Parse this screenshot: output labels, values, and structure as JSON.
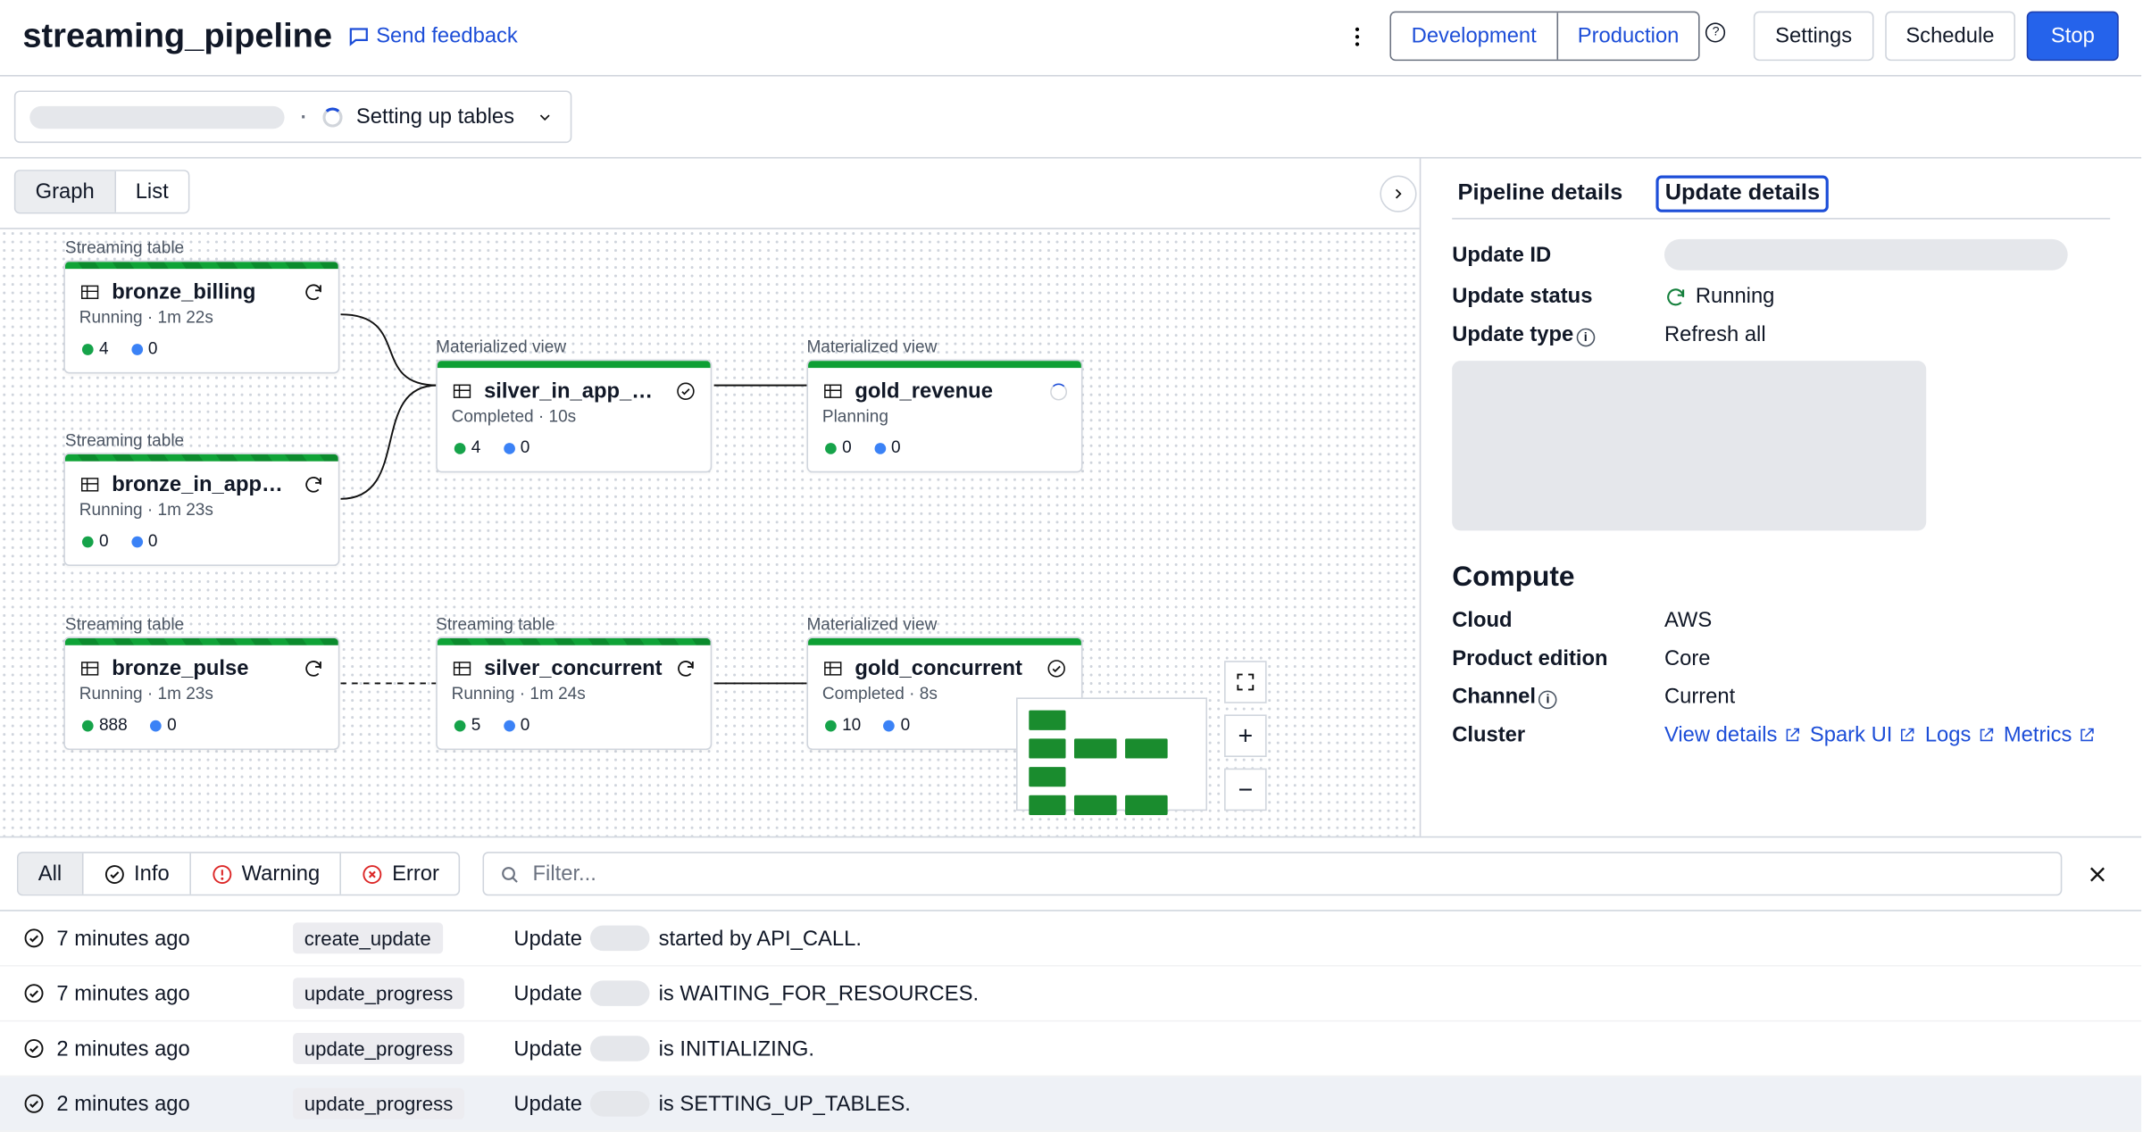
{
  "header": {
    "title": "streaming_pipeline",
    "feedback": "Send feedback",
    "env": {
      "dev": "Development",
      "prod": "Production"
    },
    "settings": "Settings",
    "schedule": "Schedule",
    "stop": "Stop"
  },
  "status_pill": {
    "text": "Setting up tables"
  },
  "view_tabs": {
    "graph": "Graph",
    "list": "List"
  },
  "groups": {
    "stream1": "Streaming table",
    "stream2": "Streaming table",
    "stream3": "Streaming table",
    "stream4": "Streaming table",
    "mat1": "Materialized view",
    "mat2": "Materialized view",
    "mat3": "Materialized view"
  },
  "nodes": {
    "bronze_billing": {
      "name": "bronze_billing",
      "meta": "Running · 1m 22s",
      "g": "4",
      "b": "0",
      "icon": "refresh"
    },
    "bronze_in_app": {
      "name": "bronze_in_app_pu…",
      "meta": "Running · 1m 23s",
      "g": "0",
      "b": "0",
      "icon": "refresh"
    },
    "silver_in_app": {
      "name": "silver_in_app_purc…",
      "meta": "Completed · 10s",
      "g": "4",
      "b": "0",
      "icon": "check"
    },
    "gold_revenue": {
      "name": "gold_revenue",
      "meta": "Planning",
      "g": "0",
      "b": "0",
      "icon": "spinner"
    },
    "bronze_pulse": {
      "name": "bronze_pulse",
      "meta": "Running · 1m 23s",
      "g": "888",
      "b": "0",
      "icon": "refresh"
    },
    "silver_concurrent": {
      "name": "silver_concurrent",
      "meta": "Running · 1m 24s",
      "g": "5",
      "b": "0",
      "icon": "refresh"
    },
    "gold_concurrent": {
      "name": "gold_concurrent",
      "meta": "Completed · 8s",
      "g": "10",
      "b": "0",
      "icon": "check"
    }
  },
  "details": {
    "tab_pipeline": "Pipeline details",
    "tab_update": "Update details",
    "update_id_k": "Update ID",
    "update_status_k": "Update status",
    "update_status_v": "Running",
    "update_type_k": "Update type",
    "update_type_v": "Refresh all",
    "compute_h": "Compute",
    "cloud_k": "Cloud",
    "cloud_v": "AWS",
    "edition_k": "Product edition",
    "edition_v": "Core",
    "channel_k": "Channel",
    "channel_v": "Current",
    "cluster_k": "Cluster",
    "links": {
      "view": "View details",
      "spark": "Spark UI",
      "logs": "Logs",
      "metrics": "Metrics"
    }
  },
  "log_filters": {
    "all": "All",
    "info": "Info",
    "warning": "Warning",
    "error": "Error",
    "placeholder": "Filter..."
  },
  "logs": [
    {
      "ts": "7 minutes ago",
      "tag": "create_update",
      "pre": "Update",
      "post": "started by API_CALL."
    },
    {
      "ts": "7 minutes ago",
      "tag": "update_progress",
      "pre": "Update",
      "post": "is WAITING_FOR_RESOURCES."
    },
    {
      "ts": "2 minutes ago",
      "tag": "update_progress",
      "pre": "Update",
      "post": "is INITIALIZING."
    },
    {
      "ts": "2 minutes ago",
      "tag": "update_progress",
      "pre": "Update",
      "post": "is SETTING_UP_TABLES."
    }
  ]
}
